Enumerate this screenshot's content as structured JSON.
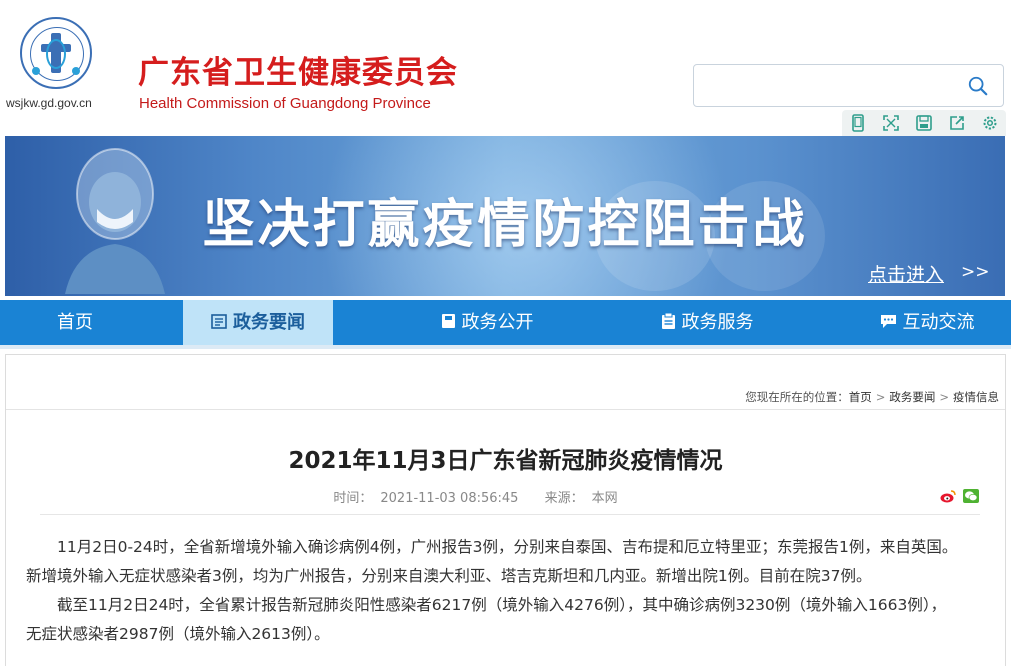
{
  "header": {
    "site_url": "wsjkw.gd.gov.cn",
    "org_name_cn": "广东省卫生健康委员会",
    "org_name_en": "Health Commission of Guangdong Province",
    "search_placeholder": "",
    "tools": [
      "mobile-icon",
      "fullscreen-icon",
      "save-icon",
      "share-icon",
      "settings-icon"
    ]
  },
  "banner": {
    "title": "坚决打赢疫情防控阻击战",
    "enter_label": "点击进入",
    "enter_arrows": ">>"
  },
  "nav": {
    "items": [
      {
        "label": "首页",
        "icon": ""
      },
      {
        "label": "政务要闻",
        "icon": "news-icon",
        "active": true
      },
      {
        "label": "政务公开",
        "icon": "book-icon"
      },
      {
        "label": "政务服务",
        "icon": "clipboard-icon"
      },
      {
        "label": "互动交流",
        "icon": "chat-icon"
      }
    ]
  },
  "breadcrumb": {
    "prefix": "您现在所在的位置：",
    "items": [
      "首页",
      "政务要闻",
      "疫情信息"
    ]
  },
  "article": {
    "title": "2021年11月3日广东省新冠肺炎疫情情况",
    "time_label": "时间：",
    "time_value": "2021-11-03 08:56:45",
    "source_label": "来源：",
    "source_value": "本网",
    "paragraphs": [
      {
        "line1": "　　11月2日0-24时，全省新增境外输入确诊病例4例，广州报告3例，分别来自泰国、吉布提和厄立特里亚；东莞报告1例，来自英国。",
        "line2": "新增境外输入无症状感染者3例，均为广州报告，分别来自澳大利亚、塔吉克斯坦和几内亚。新增出院1例。目前在院37例。"
      },
      {
        "line1": "　　截至11月2日24时，全省累计报告新冠肺炎阳性感染者6217例（境外输入4276例），其中确诊病例3230例（境外输入1663例），",
        "line2": "无症状感染者2987例（境外输入2613例）。"
      }
    ]
  },
  "colors": {
    "brand_red": "#d51d1d",
    "nav_blue": "#1a83d4",
    "nav_active": "#bfe3f8"
  }
}
